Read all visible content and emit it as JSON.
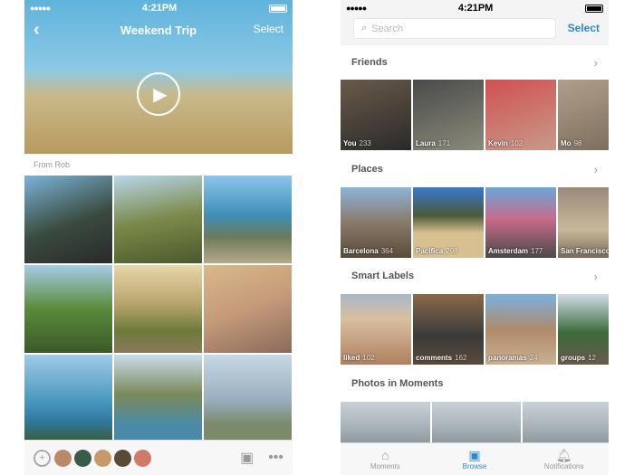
{
  "left": {
    "status": {
      "time": "4:21PM"
    },
    "header": {
      "title": "Weekend Trip",
      "back_icon": "chevron-left-icon",
      "select": "Select",
      "play_icon": "play-icon"
    },
    "from_label": "From Rob",
    "photos": [
      "linear-gradient(160deg,#7bb4d9,#3a4a3e 55%,#2a2a2a)",
      "linear-gradient(170deg,#b7d7ec,#7b8a4a 50%,#4a5a2c)",
      "linear-gradient(180deg,#8cc6ea,#3f8fb8 45%,#6c7a5a 70%,#b4a98a)",
      "linear-gradient(180deg,#a7cde6,#5a8a3a 50%,#3a5a2a)",
      "linear-gradient(180deg,#e8d7a8,#b5a46a 45%,#6c7a3a 75%,#8a7a5a)",
      "linear-gradient(160deg,#d8b888,#c49a7a 50%,#8a6a5a)",
      "linear-gradient(180deg,#9fcbe8,#4f9ac0 50%,#2f7aa0 75%,#3a5a3a)",
      "linear-gradient(180deg,#c9dcea,#7a8a5a 45%,#4a8aa8 80%)",
      "linear-gradient(180deg,#c8d8e4,#9ab0c0 50%,#7a8a6a 80%)"
    ],
    "bottom": {
      "add_person_icon": "add-person-icon",
      "avatars": [
        "#b88a6a",
        "#3a5a4a",
        "#c49a6a",
        "#5a4a3a",
        "#d07a6a"
      ],
      "add_photo_icon": "add-photo-icon",
      "more_icon": "more-icon"
    }
  },
  "right": {
    "status": {
      "time": "4:21PM"
    },
    "search": {
      "placeholder": "Search",
      "icon": "search-icon"
    },
    "select": "Select",
    "sections": [
      {
        "title": "Friends",
        "items": [
          {
            "label": "You",
            "count": "233",
            "bg": "linear-gradient(160deg,#6a5a4a,#2a2a2a)"
          },
          {
            "label": "Laura",
            "count": "171",
            "bg": "linear-gradient(160deg,#4a4a4a,#8a8a7a)"
          },
          {
            "label": "Kevin",
            "count": "102",
            "bg": "linear-gradient(160deg,#d05050,#c89a8a)"
          },
          {
            "label": "Mo",
            "count": "98",
            "bg": "linear-gradient(160deg,#b0a08a,#7a6a5a)"
          }
        ]
      },
      {
        "title": "Places",
        "items": [
          {
            "label": "Barcelona",
            "count": "364",
            "bg": "linear-gradient(180deg,#8ab4d8,#8a7a6a 50%,#5a4a3a)"
          },
          {
            "label": "Pacifica",
            "count": "298",
            "bg": "linear-gradient(180deg,#3a7ad0,#4a5a3a 40%,#d8c090 65%)"
          },
          {
            "label": "Amsterdam",
            "count": "177",
            "bg": "linear-gradient(180deg,#6aa8d8,#c86a8a 45%,#4a4a4a)"
          },
          {
            "label": "San Francisco",
            "count": "",
            "bg": "linear-gradient(180deg,#9a8a7a,#c8b89a 60%,#7a6a5a)"
          }
        ]
      },
      {
        "title": "Smart Labels",
        "items": [
          {
            "label": "liked",
            "count": "102",
            "bg": "linear-gradient(180deg,#a8b8c8,#d8c0a0 35%,#b08060)"
          },
          {
            "label": "comments",
            "count": "162",
            "bg": "linear-gradient(180deg,#8a6a4a,#3a3a3a 60%,#5a4a3a)"
          },
          {
            "label": "panoramas",
            "count": "24",
            "bg": "linear-gradient(180deg,#7ab0e0,#b08a6a 50%,#c8b090)"
          },
          {
            "label": "groups",
            "count": "12",
            "bg": "linear-gradient(180deg,#d0dce8,#3a6a3a 55%,#6a5a4a)"
          }
        ]
      }
    ],
    "moments_title": "Photos in Moments",
    "tabs": [
      {
        "label": "Moments",
        "icon": "home-icon",
        "active": false
      },
      {
        "label": "Browse",
        "icon": "browse-icon",
        "active": true
      },
      {
        "label": "Notifications",
        "icon": "bell-icon",
        "active": false
      }
    ],
    "accent": "#2d88d9"
  }
}
